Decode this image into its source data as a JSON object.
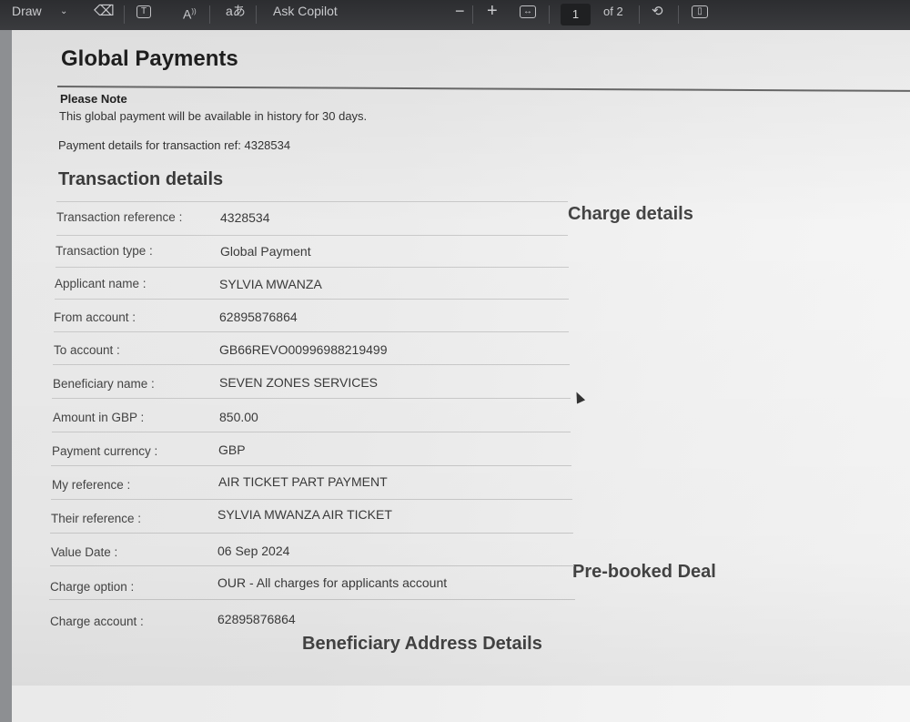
{
  "toolbar": {
    "draw_label": "Draw",
    "text_icon_label": "T",
    "read_aloud_label": "A",
    "translate_label": "aあ",
    "copilot_label": "Ask Copilot",
    "zoom_out_label": "−",
    "zoom_in_label": "+",
    "page_number": "1",
    "page_total": "of 2"
  },
  "document": {
    "title": "Global Payments",
    "note_heading": "Please Note",
    "note_text": "This global payment will be available in history for 30 days.",
    "ref_line": "Payment details for transaction ref: 4328534",
    "section_heading": "Transaction details",
    "charge_heading": "Charge details",
    "prebooked_heading": "Pre-booked Deal",
    "beneficiary_heading": "Beneficiary Address Details",
    "rows": [
      {
        "label": "Transaction reference :",
        "value": "4328534"
      },
      {
        "label": "Transaction type :",
        "value": "Global Payment"
      },
      {
        "label": "Applicant name :",
        "value": "SYLVIA MWANZA"
      },
      {
        "label": "From account :",
        "value": "62895876864"
      },
      {
        "label": "To account :",
        "value": "GB66REVO00996988219499"
      },
      {
        "label": "Beneficiary name :",
        "value": "SEVEN ZONES SERVICES"
      },
      {
        "label": "Amount in GBP :",
        "value": "850.00"
      },
      {
        "label": "Payment currency :",
        "value": "GBP"
      },
      {
        "label": "My reference :",
        "value": "AIR TICKET PART PAYMENT"
      },
      {
        "label": "Their reference :",
        "value": "SYLVIA MWANZA AIR TICKET"
      },
      {
        "label": "Value Date :",
        "value": "06 Sep 2024"
      },
      {
        "label": "Charge option :",
        "value": "OUR - All charges for applicants account"
      },
      {
        "label": "Charge account :",
        "value": "62895876864"
      }
    ]
  }
}
